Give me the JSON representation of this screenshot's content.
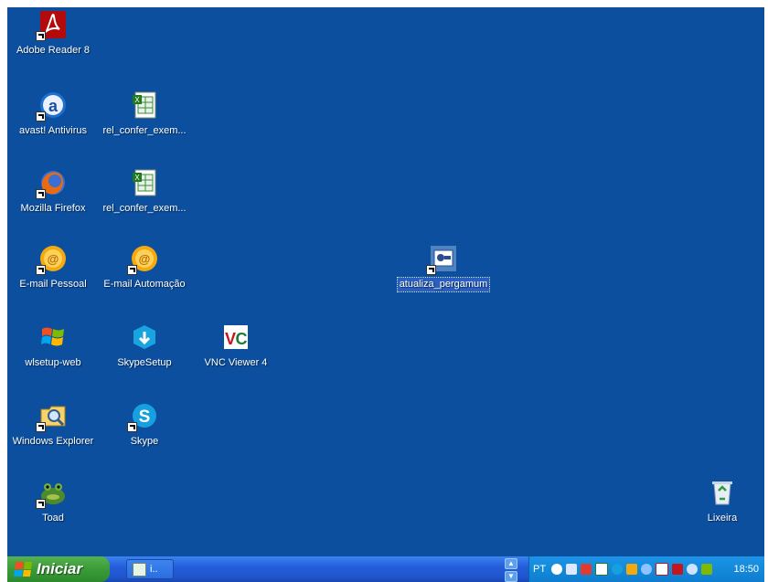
{
  "desktop": {
    "icons": [
      {
        "label": "Adobe Reader 8",
        "icon": "adobe-reader-icon"
      },
      {
        "label": "avast! Antivirus",
        "icon": "avast-icon"
      },
      {
        "label": "rel_confer_exem...",
        "icon": "excel-file-icon"
      },
      {
        "label": "Mozilla Firefox",
        "icon": "firefox-icon"
      },
      {
        "label": "rel_confer_exem...",
        "icon": "excel-file-icon"
      },
      {
        "label": "E-mail Pessoal",
        "icon": "email-icon"
      },
      {
        "label": "E-mail Automação",
        "icon": "email-icon"
      },
      {
        "label": "atualiza_pergamum",
        "icon": "batch-file-icon"
      },
      {
        "label": "wlsetup-web",
        "icon": "windows-live-icon"
      },
      {
        "label": "SkypeSetup",
        "icon": "skype-setup-icon"
      },
      {
        "label": "VNC Viewer 4",
        "icon": "vnc-icon"
      },
      {
        "label": "Windows Explorer",
        "icon": "explorer-icon"
      },
      {
        "label": "Skype",
        "icon": "skype-icon"
      },
      {
        "label": "Toad",
        "icon": "toad-icon"
      },
      {
        "label": "Lixeira",
        "icon": "recycle-bin-icon"
      }
    ]
  },
  "taskbar": {
    "start_label": "Iniciar",
    "task_label": "i..",
    "language": "PT",
    "clock": "18:50"
  },
  "colors": {
    "desktop": "#0b4f9e",
    "taskbar": "#245edb",
    "start": "#3a9b37",
    "tray": "#138ad9"
  }
}
